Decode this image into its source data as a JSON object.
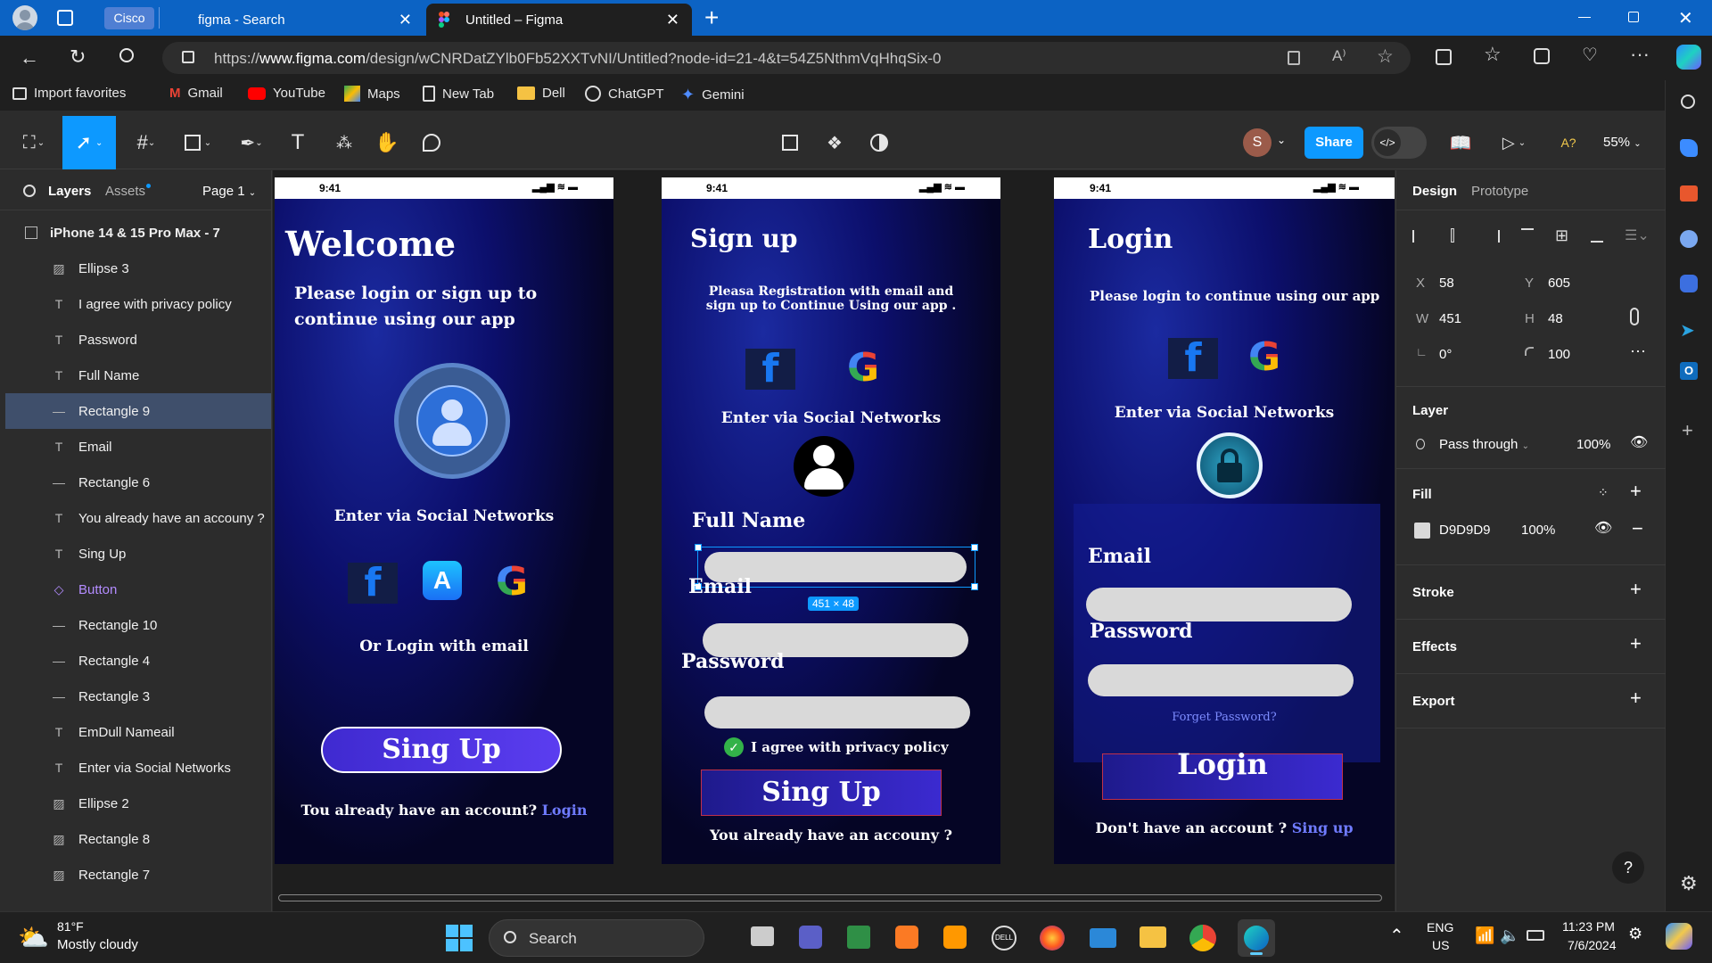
{
  "browser": {
    "profile_tab": "Cisco",
    "tabs": [
      {
        "label": "figma - Search"
      },
      {
        "label": "Untitled – Figma"
      }
    ],
    "url_prefix": "https://",
    "url_host": "www.figma.com",
    "url_path": "/design/wCNRDatZYlb0Fb52XXTvNI/Untitled?node-id=21-4&t=54Z5NthmVqHhqSix-0",
    "favorites": [
      "Import favorites",
      "Gmail",
      "YouTube",
      "Maps",
      "New Tab",
      "Dell",
      "ChatGPT",
      "Gemini"
    ]
  },
  "figma": {
    "share_label": "Share",
    "avatar_letter": "S",
    "zoom": "55%",
    "missing_fonts": "A?",
    "layers_tab": "Layers",
    "assets_tab": "Assets",
    "page": "Page 1",
    "frame_name": "iPhone 14 & 15 Pro Max - 7",
    "layers": [
      {
        "label": "Ellipse 3",
        "icon": "image-icon"
      },
      {
        "label": "I agree with privacy policy",
        "icon": "text-icon"
      },
      {
        "label": "Password",
        "icon": "text-icon"
      },
      {
        "label": "Full Name",
        "icon": "text-icon"
      },
      {
        "label": "Rectangle 9",
        "icon": "line-icon"
      },
      {
        "label": "Email",
        "icon": "text-icon"
      },
      {
        "label": "Rectangle 6",
        "icon": "line-icon"
      },
      {
        "label": "You already have an accouny ?",
        "icon": "text-icon"
      },
      {
        "label": "Sing Up",
        "icon": "text-icon"
      },
      {
        "label": "Button",
        "icon": "component-icon"
      },
      {
        "label": "Rectangle 10",
        "icon": "line-icon"
      },
      {
        "label": "Rectangle 4",
        "icon": "line-icon"
      },
      {
        "label": "Rectangle 3",
        "icon": "line-icon"
      },
      {
        "label": "EmDull Nameail",
        "icon": "text-icon"
      },
      {
        "label": "Enter via Social Networks",
        "icon": "text-icon"
      },
      {
        "label": "Ellipse 2",
        "icon": "image-icon"
      },
      {
        "label": "Rectangle 8",
        "icon": "image-icon"
      },
      {
        "label": "Rectangle 7",
        "icon": "image-icon"
      }
    ],
    "selected_layer": "Rectangle 9",
    "design_tab": "Design",
    "prototype_tab": "Prototype",
    "props": {
      "x_label": "X",
      "x": "58",
      "y_label": "Y",
      "y": "605",
      "w_label": "W",
      "w": "451",
      "h_label": "H",
      "h": "48",
      "rotation": "0°",
      "radius": "100"
    },
    "layer_section": "Layer",
    "blend_mode": "Pass through",
    "opacity": "100%",
    "fill_section": "Fill",
    "fill_hex": "D9D9D9",
    "fill_opacity": "100%",
    "stroke_section": "Stroke",
    "effects_section": "Effects",
    "export_section": "Export",
    "help": "?",
    "selection_size": "451 × 48",
    "fill_color": "#d9d9d9",
    "accent": "#0d99ff"
  },
  "phones": {
    "time": "9:41",
    "welcome": {
      "title": "Welcome",
      "subtitle": "Please login or sign up  to continue using our app",
      "social": "Enter via Social Networks",
      "email_login": "Or Login with email",
      "button": "Sing Up",
      "footer": "Tou already have an account?",
      "footer_link": "Login"
    },
    "signup": {
      "title": "Sign up",
      "subtitle": "Pleasa Registration with email and sign up to Continue Using our app .",
      "social": "Enter via Social Networks",
      "fullname": "Full Name",
      "email": "Email",
      "password": "Password",
      "agree": "I agree with privacy policy",
      "button": "Sing Up",
      "footer": "You already have an accouny ?"
    },
    "login": {
      "title": "Login",
      "subtitle": "Please login to continue  using our app",
      "social": "Enter via Social Networks",
      "email": "Email",
      "password": "Password",
      "forgot": "Forget Password?",
      "button": "Login",
      "footer": "Don't have an account ?",
      "footer_link": "Sing up"
    }
  },
  "taskbar": {
    "temp": "81°F",
    "weather": "Mostly cloudy",
    "search": "Search",
    "lang1": "ENG",
    "lang2": "US",
    "time": "11:23 PM",
    "date": "7/6/2024"
  }
}
